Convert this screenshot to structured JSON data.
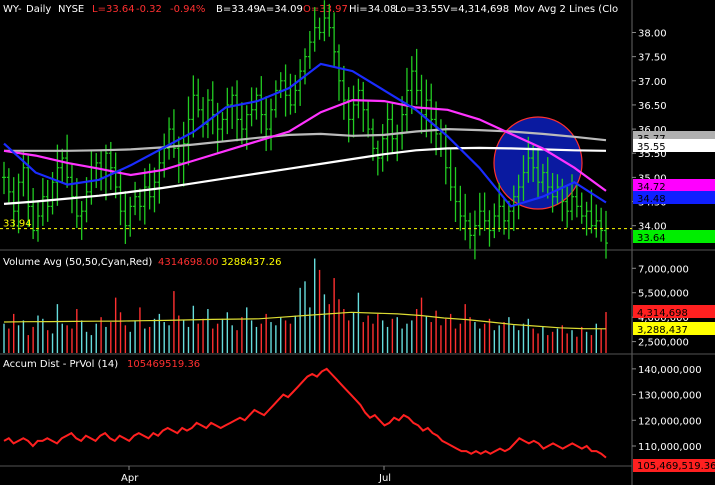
{
  "header": {
    "symbol": "WY",
    "period": "Daily",
    "exchange": "NYSE",
    "last": "L=33.64",
    "change": "-0.32",
    "change_pct": "-0.94%",
    "bid": "B=33.49",
    "ask": "A=34.09",
    "open": "O=33.97",
    "high": "Hi=34.08",
    "low": "Lo=33.55",
    "volume": "V=4,314,698",
    "study": "Mov Avg 2 Lines (Clo"
  },
  "price_panel": {
    "ref_line_label": "33.94",
    "y_ticks": [
      "38.00",
      "37.50",
      "37.00",
      "36.50",
      "36.00",
      "35.50",
      "35.00",
      "34.50",
      "34.00"
    ],
    "boxes": [
      {
        "label": "35.77",
        "value": 35.77,
        "bg": "#b0b0b0",
        "fg": "#000000"
      },
      {
        "label": "35.55",
        "value": 35.55,
        "bg": "#ffffff",
        "fg": "#000000"
      },
      {
        "label": "34.72",
        "value": 34.72,
        "bg": "#ff00ff",
        "fg": "#000000"
      },
      {
        "label": "34.48",
        "value": 34.48,
        "bg": "#1020ff",
        "fg": "#000000"
      },
      {
        "label": "33.64",
        "value": 33.64,
        "bg": "#00ee00",
        "fg": "#000000"
      }
    ]
  },
  "volume_panel": {
    "title": "Volume Avg (50,50,Cyan,Red)",
    "value1": "4314698.00",
    "value2": "3288437.26",
    "y_ticks": [
      "7,000,000",
      "5,500,000",
      "4,000,000",
      "2,500,000"
    ],
    "boxes": [
      {
        "label": "4,314,698",
        "bg": "#ff2020",
        "fg": "#000000"
      },
      {
        "label": "3,288,437",
        "bg": "#ffff00",
        "fg": "#000000"
      }
    ]
  },
  "ad_panel": {
    "title": "Accum Dist - PrVol (14)",
    "value": "105469519.36",
    "y_ticks": [
      "140,000,000",
      "130,000,000",
      "120,000,000",
      "110,000,000"
    ],
    "box": {
      "label": "105,469,519.36",
      "bg": "#ff2020",
      "fg": "#000000"
    }
  },
  "x_labels": [
    "Apr",
    "Jul"
  ],
  "colors": {
    "price_bars": "#22cc22",
    "ma_white": "#ffffff",
    "ma_gray": "#bbbbbb",
    "ma_magenta": "#ff33ff",
    "ma_blue": "#1a2cff",
    "ellipse_fill": "#0a1aa0",
    "ellipse_stroke": "#ff3030",
    "vol_up": "#66dddd",
    "vol_down": "#ff3030",
    "vol_avg": "#dddd33",
    "ad_line": "#ff2020",
    "ref_line": "#ffff00",
    "header_red": "#ff3030",
    "header_white": "#ffffff"
  },
  "chart_data": [
    {
      "type": "line",
      "title": "WY - Daily NYSE",
      "x_tick_labels": [
        "Apr",
        "Jul"
      ],
      "ylim": [
        33.6,
        38.3
      ],
      "series": [
        {
          "name": "Close",
          "values": [
            35.0,
            34.7,
            34.3,
            34.9,
            35.2,
            34.4,
            33.9,
            34.2,
            34.6,
            34.4,
            34.9,
            35.2,
            35.4,
            35.0,
            34.6,
            34.2,
            34.3,
            34.7,
            35.2,
            35.3,
            35.0,
            35.5,
            35.2,
            34.8,
            34.3,
            34.0,
            34.4,
            34.6,
            34.4,
            34.8,
            34.6,
            34.9,
            35.3,
            35.6,
            36.0,
            35.6,
            35.3,
            35.7,
            36.2,
            36.7,
            36.4,
            36.1,
            36.6,
            36.3,
            36.0,
            36.2,
            36.5,
            36.7,
            36.2,
            36.0,
            36.3,
            36.4,
            36.7,
            36.3,
            36.0,
            36.4,
            36.8,
            37.0,
            36.7,
            36.5,
            36.8,
            37.2,
            37.5,
            37.8,
            38.1,
            38.0,
            38.3,
            38.1,
            37.6,
            37.0,
            36.6,
            36.2,
            36.5,
            36.8,
            36.4,
            36.0,
            35.6,
            35.4,
            35.8,
            36.2,
            35.8,
            35.9,
            36.3,
            36.8,
            37.2,
            36.8,
            36.3,
            36.6,
            36.2,
            35.9,
            35.6,
            35.2,
            34.8,
            34.5,
            34.2,
            34.1,
            33.8,
            34.0,
            34.3,
            34.1,
            33.9,
            34.2,
            34.4,
            34.1,
            34.3,
            34.6,
            34.8,
            35.1,
            35.4,
            35.2,
            34.9,
            35.1,
            34.8,
            34.6,
            34.8,
            34.5,
            34.3,
            34.6,
            34.4,
            34.2,
            34.3,
            34.0,
            34.1,
            33.9,
            33.64
          ]
        },
        {
          "name": "Mov Avg 1",
          "values": [
            35.77,
            35.74,
            35.72,
            35.73,
            35.78,
            35.82,
            35.86,
            35.9,
            35.92,
            35.89,
            35.84,
            35.77
          ]
        },
        {
          "name": "Mov Avg 2",
          "values": [
            34.45,
            34.52,
            34.58,
            34.68,
            34.8,
            34.95,
            35.1,
            35.3,
            35.48,
            35.55,
            35.58,
            35.55
          ]
        }
      ]
    },
    {
      "type": "bar",
      "title": "Volume Avg (50,50,Cyan,Red)",
      "ylim": [
        1800000,
        8000000
      ],
      "y_tick_labels": [
        "7,000,000",
        "5,500,000",
        "4,000,000",
        "2,500,000"
      ],
      "series": [
        {
          "name": "Volume",
          "values": [
            3600000,
            3300000,
            4200000,
            3500000,
            3800000,
            2900000,
            3400000,
            4100000,
            3900000,
            3200000,
            3000000,
            4800000,
            3600000,
            3500000,
            3300000,
            4500000,
            3800000,
            3100000,
            2900000,
            3600000,
            4000000,
            3400000,
            3700000,
            5200000,
            4300000,
            3500000,
            3100000,
            3800000,
            4600000,
            3300000,
            3400000,
            3900000,
            4200000,
            3700000,
            3500000,
            5600000,
            4100000,
            3800000,
            3400000,
            4700000,
            3600000,
            3900000,
            4500000,
            3300000,
            3600000,
            3900000,
            4300000,
            3500000,
            3200000,
            4000000,
            4600000,
            3800000,
            3400000,
            3600000,
            4200000,
            3700000,
            3500000,
            4000000,
            3800000,
            3600000,
            4100000,
            5800000,
            6200000,
            4600000,
            7600000,
            6900000,
            5400000,
            4800000,
            6400000,
            5100000,
            4500000,
            3800000,
            4300000,
            5500000,
            3700000,
            4100000,
            3600000,
            4200000,
            3800000,
            3400000,
            3900000,
            4000000,
            3300000,
            3600000,
            3800000,
            4500000,
            5200000,
            4100000,
            3700000,
            4400000,
            3500000,
            3900000,
            4200000,
            3300000,
            3600000,
            4800000,
            4000000,
            3700000,
            3300000,
            3600000,
            3900000,
            3200000,
            3500000,
            3700000,
            4000000,
            3500000,
            3200000,
            3600000,
            3900000,
            3300000,
            3000000,
            3400000,
            2900000,
            3100000,
            3300000,
            3500000,
            3000000,
            3200000,
            2800000,
            3400000,
            3100000,
            2900000,
            3600000,
            3300000,
            4314698
          ]
        },
        {
          "name": "Average",
          "values": [
            3700000,
            3720000,
            3730000,
            3740000,
            3750000,
            3760000,
            3780000,
            3800000,
            3830000,
            3860000,
            3880000,
            3900000,
            4000000,
            4100000,
            4200000,
            4300000,
            4250000,
            4200000,
            4100000,
            3950000,
            3850000,
            3700000,
            3550000,
            3450000,
            3350000,
            3300000,
            3288437
          ]
        }
      ]
    },
    {
      "type": "line",
      "title": "Accum Dist - PrVol (14)",
      "ylim": [
        103000000,
        145000000
      ],
      "y_tick_labels": [
        "140,000,000",
        "130,000,000",
        "120,000,000",
        "110,000,000"
      ],
      "series": [
        {
          "name": "Accum Dist",
          "values": [
            112,
            113,
            111,
            112,
            113,
            112,
            110,
            112,
            112,
            113,
            112,
            111,
            113,
            114,
            115,
            113,
            112,
            114,
            113,
            112,
            114,
            115,
            113,
            112,
            114,
            113,
            112,
            114,
            115,
            114,
            113,
            115,
            114,
            116,
            117,
            116,
            115,
            117,
            116,
            117,
            119,
            118,
            117,
            119,
            118,
            117,
            118,
            119,
            120,
            121,
            120,
            122,
            124,
            123,
            122,
            124,
            126,
            128,
            130,
            129,
            131,
            133,
            135,
            137,
            138,
            137,
            139,
            140,
            138,
            136,
            134,
            132,
            130,
            128,
            126,
            123,
            121,
            122,
            120,
            118,
            119,
            121,
            120,
            122,
            121,
            119,
            118,
            116,
            117,
            115,
            114,
            112,
            111,
            110,
            109,
            108,
            108,
            107,
            108,
            107,
            108,
            107,
            108,
            109,
            108,
            109,
            111,
            113,
            112,
            111,
            112,
            111,
            109,
            110,
            111,
            110,
            109,
            110,
            111,
            110,
            109,
            110,
            108,
            108,
            107,
            105.47
          ]
        }
      ]
    }
  ]
}
